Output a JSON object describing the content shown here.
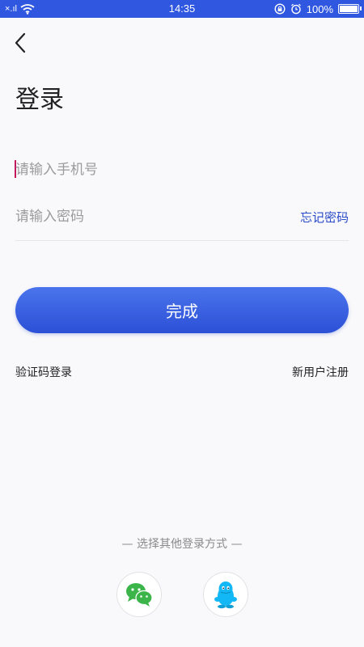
{
  "status_bar": {
    "signal_text": "×.ıl",
    "time": "14:35",
    "battery_percent": "100%",
    "battery_level": 1.0,
    "background": "#2f57e0"
  },
  "header": {
    "title": "登录"
  },
  "form": {
    "phone_placeholder": "请输入手机号",
    "password_placeholder": "请输入密码",
    "forgot_label": "忘记密码",
    "submit_label": "完成",
    "accent": "#2c50d6"
  },
  "links": {
    "sms_login": "验证码登录",
    "register": "新用户注册"
  },
  "other_login": {
    "label": "— 选择其他登录方式 —",
    "options": [
      {
        "icon": "wechat-icon",
        "color": "#3bb54a"
      },
      {
        "icon": "qq-icon",
        "color": "#12b7f5"
      }
    ]
  }
}
